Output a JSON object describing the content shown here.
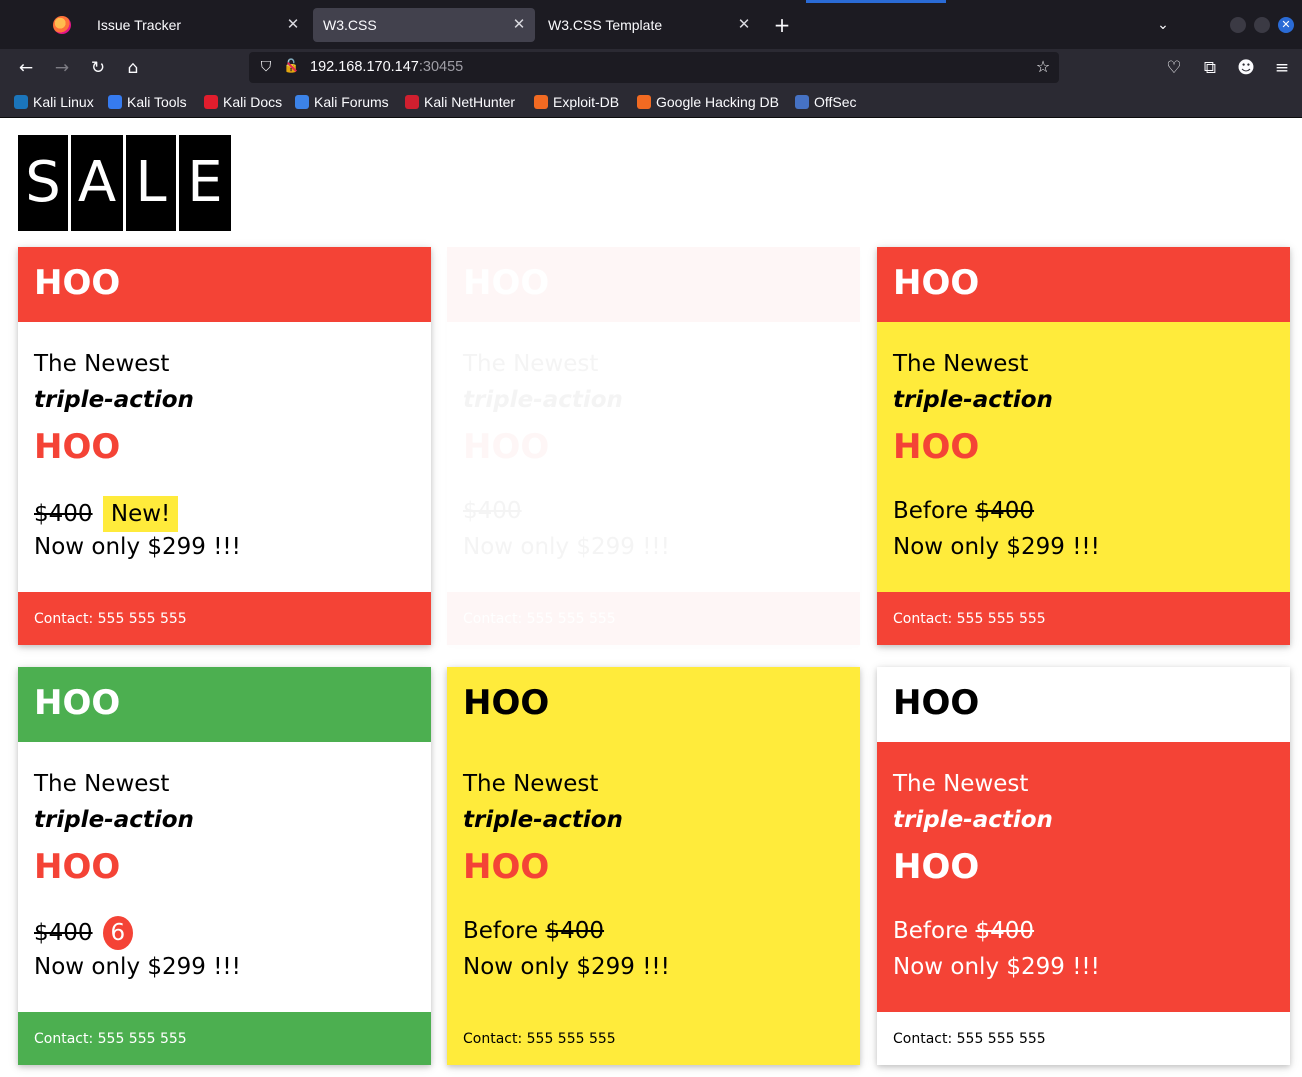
{
  "browser": {
    "tabs": [
      {
        "label": "Issue Tracker",
        "active": false
      },
      {
        "label": "W3.CSS",
        "active": true
      },
      {
        "label": "W3.CSS Template",
        "active": false
      }
    ],
    "new_tab_icon": "plus-icon",
    "url_host": "192.168.170.147",
    "url_port": ":30455",
    "bookmarks": [
      {
        "label": "Kali Linux",
        "color": "#1b75bb"
      },
      {
        "label": "Kali Tools",
        "color": "#367bf0"
      },
      {
        "label": "Kali Docs",
        "color": "#e11d2d"
      },
      {
        "label": "Kali Forums",
        "color": "#3c83e8"
      },
      {
        "label": "Kali NetHunter",
        "color": "#d01f2f"
      },
      {
        "label": "Exploit-DB",
        "color": "#f16a22"
      },
      {
        "label": "Google Hacking DB",
        "color": "#f16a22"
      },
      {
        "label": "OffSec",
        "color": "#4672c4"
      }
    ]
  },
  "sale": [
    "S",
    "A",
    "L",
    "E"
  ],
  "cards": [
    {
      "header": "HOO",
      "line1": "The Newest",
      "line2": "triple-action",
      "line3": "HOO",
      "price_prefix": "",
      "old_price": "$400",
      "tag": "New!",
      "now": "Now only $299 !!!",
      "footer": "Contact: 555 555 555"
    },
    {
      "header": "HOO",
      "line1": "The Newest",
      "line2": "triple-action",
      "line3": "HOO",
      "price_prefix": "",
      "old_price": "$400",
      "tag": "",
      "now": "Now only $299 !!!",
      "footer": "Contact: 555 555 555"
    },
    {
      "header": "HOO",
      "line1": "The Newest",
      "line2": "triple-action",
      "line3": "HOO",
      "price_prefix": "Before ",
      "old_price": "$400",
      "tag": "",
      "now": "Now only $299 !!!",
      "footer": "Contact: 555 555 555"
    },
    {
      "header": "HOO",
      "line1": "The Newest",
      "line2": "triple-action",
      "line3": "HOO",
      "price_prefix": "",
      "old_price": "$400",
      "badge": "6",
      "now": "Now only $299 !!!",
      "footer": "Contact: 555 555 555"
    },
    {
      "header": "HOO",
      "line1": "The Newest",
      "line2": "triple-action",
      "line3": "HOO",
      "price_prefix": "Before ",
      "old_price": "$400",
      "tag": "",
      "now": "Now only $299 !!!",
      "footer": "Contact: 555 555 555"
    },
    {
      "header": "HOO",
      "line1": "The Newest",
      "line2": "triple-action",
      "line3": "HOO",
      "price_prefix": "Before ",
      "old_price": "$400",
      "tag": "",
      "now": "Now only $299 !!!",
      "footer": "Contact: 555 555 555"
    }
  ],
  "colors": {
    "red": "#f44336",
    "green": "#4caf50",
    "yellow": "#ffeb3b",
    "black": "#000000"
  }
}
